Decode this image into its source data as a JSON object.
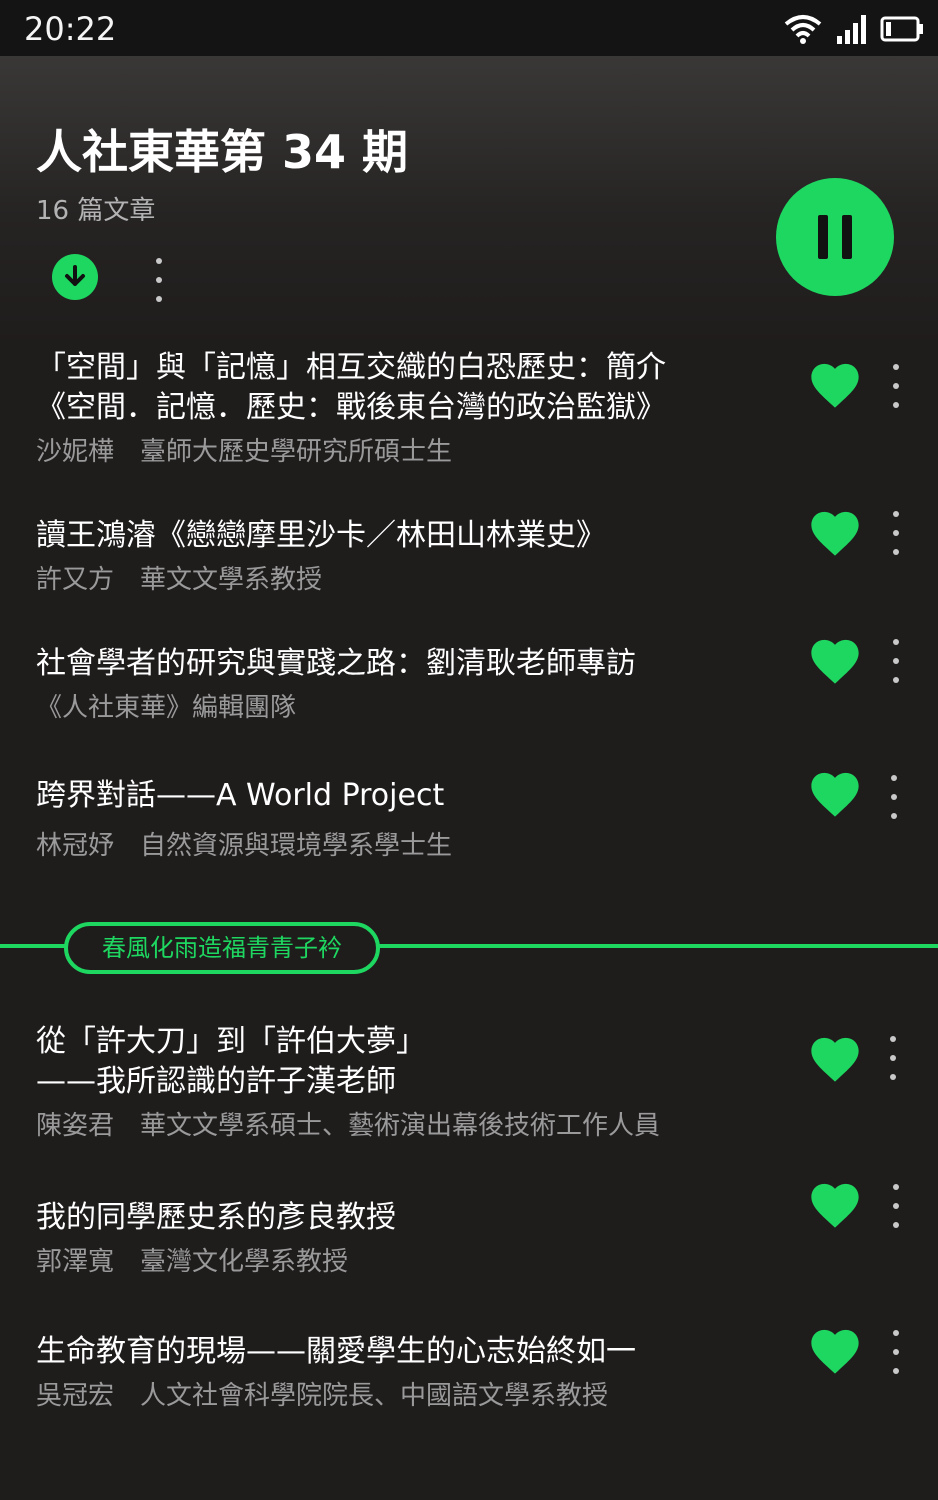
{
  "status_bar": {
    "time": "20:22"
  },
  "playlist": {
    "title": "人社東華第 34 期",
    "article_count": "16 篇文章"
  },
  "colors": {
    "accent": "#1ed760",
    "background": "#1f1c1c",
    "secondary_text": "#9a9a9a"
  },
  "icons": {
    "download": "download-icon",
    "more": "more-vertical-icon",
    "pause": "pause-icon",
    "heart": "heart-icon",
    "wifi": "wifi-icon",
    "signal": "signal-icon",
    "battery": "battery-icon"
  },
  "articles": [
    {
      "title": "「空間」與「記憶」相互交織的白恐歷史：簡介\n《空間．記憶．歷史：戰後東台灣的政治監獄》",
      "subtitle": "沙妮樺　臺師大歷史學研究所碩士生",
      "liked": true
    },
    {
      "title": "讀王鴻濬《戀戀摩里沙卡／林田山林業史》",
      "subtitle": "許又方　華文文學系教授",
      "liked": true
    },
    {
      "title": "社會學者的研究與實踐之路：劉清耿老師專訪",
      "subtitle": "《人社東華》編輯團隊",
      "liked": true
    },
    {
      "title": "跨界對話——A World Project",
      "subtitle": "林冠妤　自然資源與環境學系學士生",
      "liked": true
    }
  ],
  "section": {
    "label": "春風化雨造福青青子衿"
  },
  "section_articles": [
    {
      "title": "從「許大刀」到「許伯大夢」\n——我所認識的許子漢老師",
      "subtitle": "陳姿君　華文文學系碩士、藝術演出幕後技術工作人員",
      "liked": true
    },
    {
      "title": "我的同學歷史系的彥良教授",
      "subtitle": "郭澤寬　臺灣文化學系教授",
      "liked": true
    },
    {
      "title": "生命教育的現場——關愛學生的心志始終如一",
      "subtitle": "吳冠宏　人文社會科學院院長、中國語文學系教授",
      "liked": true
    }
  ]
}
